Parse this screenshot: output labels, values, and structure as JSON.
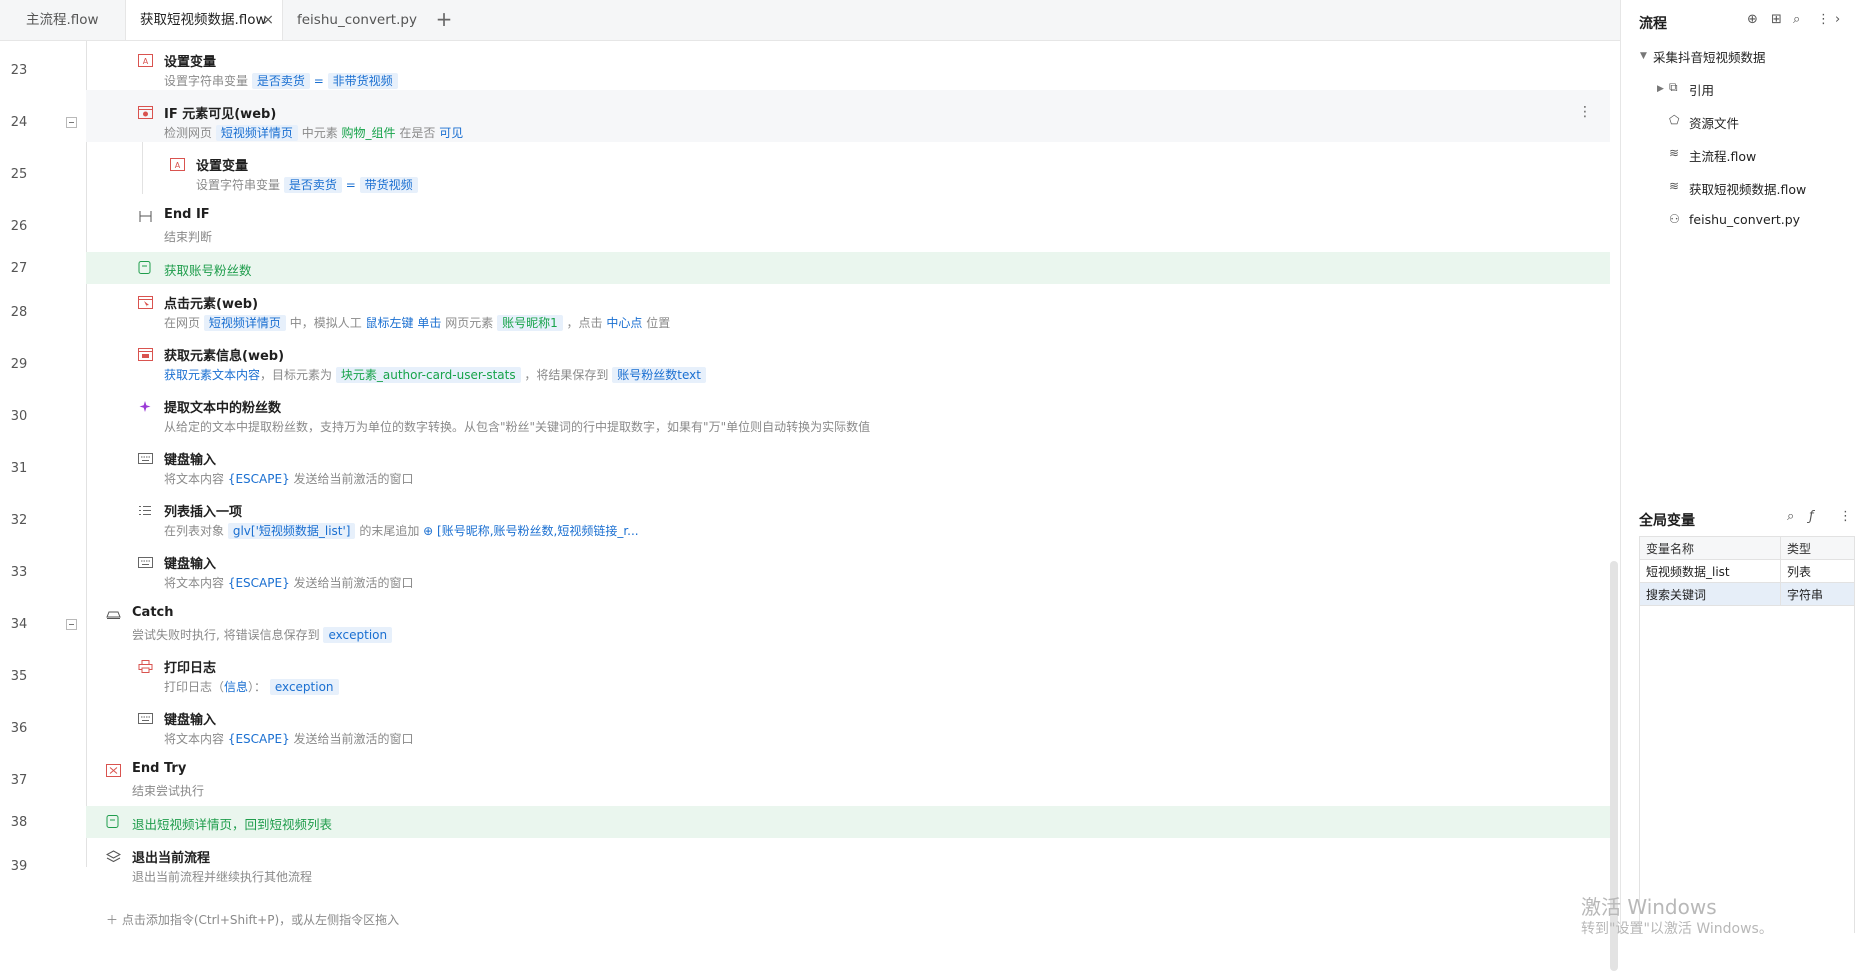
{
  "tabs": [
    {
      "label": "主流程.flow"
    },
    {
      "label": "获取短视频数据.flow",
      "close": "×"
    },
    {
      "label": "feishu_convert.py"
    }
  ],
  "tab_add": "+",
  "rows": {
    "r23": {
      "no": "23",
      "title": "设置变量",
      "d1": "设置字符串变量",
      "d2": "是否卖货",
      "d3": "=",
      "d4": "非带货视频"
    },
    "r24": {
      "no": "24",
      "title": "IF 元素可见(web)",
      "d1": "检测网页",
      "d2": "短视频详情页",
      "d3": "中元素",
      "d4": "购物_组件",
      "d5": "在是否",
      "d6": "可见",
      "menu": "⋮"
    },
    "r25": {
      "no": "25",
      "title": "设置变量",
      "d1": "设置字符串变量",
      "d2": "是否卖货",
      "d3": "=",
      "d4": "带货视频"
    },
    "r26": {
      "no": "26",
      "title": "End IF",
      "d1": "结束判断"
    },
    "r27": {
      "no": "27",
      "comment": "获取账号粉丝数"
    },
    "r28": {
      "no": "28",
      "title": "点击元素(web)",
      "d1": "在网页",
      "d2": "短视频详情页",
      "d3": "中，模拟人工",
      "d4": "鼠标左键",
      "d5": "单击",
      "d6": "网页元素",
      "d7": "账号昵称1",
      "d8": "，点击",
      "d9": "中心点",
      "d10": "位置"
    },
    "r29": {
      "no": "29",
      "title": "获取元素信息(web)",
      "d1": "获取元素文本内容",
      "d2": "，目标元素为",
      "d3": "块元素_author-card-user-stats",
      "d4": "，将结果保存到",
      "d5": "账号粉丝数text"
    },
    "r30": {
      "no": "30",
      "title": "提取文本中的粉丝数",
      "d1": "从给定的文本中提取粉丝数，支持万为单位的数字转换。从包含\"粉丝\"关键词的行中提取数字，如果有\"万\"单位则自动转换为实际数值"
    },
    "r31": {
      "no": "31",
      "title": "键盘输入",
      "d1": "将文本内容",
      "d2": "{ESCAPE}",
      "d3": "发送给当前激活的窗口"
    },
    "r32": {
      "no": "32",
      "title": "列表插入一项",
      "d1": "在列表对象",
      "d2": "glv['短视频数据_list']",
      "d3": "的末尾追加",
      "d4": "⊕ [账号昵称,账号粉丝数,短视频链接_r..."
    },
    "r33": {
      "no": "33",
      "title": "键盘输入",
      "d1": "将文本内容",
      "d2": "{ESCAPE}",
      "d3": "发送给当前激活的窗口"
    },
    "r34": {
      "no": "34",
      "title": "Catch",
      "d1": "尝试失败时执行, 将错误信息保存到",
      "d2": "exception"
    },
    "r35": {
      "no": "35",
      "title": "打印日志",
      "d1": "打印日志（",
      "d2": "信息",
      "d3": "）：",
      "d4": "exception"
    },
    "r36": {
      "no": "36",
      "title": "键盘输入",
      "d1": "将文本内容",
      "d2": "{ESCAPE}",
      "d3": "发送给当前激活的窗口"
    },
    "r37": {
      "no": "37",
      "title": "End Try",
      "d1": "结束尝试执行"
    },
    "r38": {
      "no": "38",
      "comment": "退出短视频详情页，回到短视频列表"
    },
    "r39": {
      "no": "39",
      "title": "退出当前流程",
      "d1": "退出当前流程并继续执行其他流程"
    }
  },
  "add_hint": "＋  点击添加指令(Ctrl+Shift+P)，或从左侧指令区拖入",
  "flow_panel": {
    "title": "流程",
    "tree": {
      "root": "采集抖音短视频数据",
      "items": [
        "引用",
        "资源文件",
        "主流程.flow",
        "获取短视频数据.flow",
        "feishu_convert.py"
      ]
    }
  },
  "vars_panel": {
    "title": "全局变量",
    "col_name": "变量名称",
    "col_type": "类型",
    "rows": [
      {
        "name": "短视频数据_list",
        "type": "列表"
      },
      {
        "name": "搜索关键词",
        "type": "字符串"
      }
    ]
  },
  "watermark": {
    "line1": "激活 Windows",
    "line2": "转到\"设置\"以激活 Windows。"
  }
}
